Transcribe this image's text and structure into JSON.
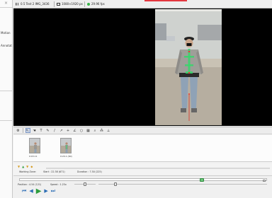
{
  "info_bar": {
    "file_label": "0.5 Test 2 IMG_3436",
    "resolution": "1080×1920 px",
    "framerate": "29.96 fps",
    "accent_color": "#e4383f"
  },
  "left_panel": {
    "items": [
      "Motion",
      "Annotati"
    ]
  },
  "toolbar": {
    "tools": [
      {
        "icon": "pointer-icon",
        "glyph": "↖"
      },
      {
        "icon": "hand-icon",
        "glyph": "☚"
      },
      {
        "icon": "text-icon",
        "glyph": "T"
      },
      {
        "icon": "pencil-icon",
        "glyph": "✎"
      },
      {
        "icon": "line-icon",
        "glyph": "/"
      },
      {
        "icon": "arrow-icon",
        "glyph": "↗"
      },
      {
        "icon": "cross-icon",
        "glyph": "+"
      },
      {
        "icon": "angle-icon",
        "glyph": "∠"
      },
      {
        "icon": "circle-icon",
        "glyph": "○"
      },
      {
        "icon": "grid-icon",
        "glyph": "▦"
      },
      {
        "icon": "magnifier-icon",
        "glyph": "⌕"
      },
      {
        "icon": "plot-icon",
        "glyph": "⁂"
      },
      {
        "icon": "ruler-icon",
        "glyph": "⟂"
      }
    ]
  },
  "keyframes": [
    {
      "label": "0:03.11"
    },
    {
      "label": "0:20.1 (60)"
    }
  ],
  "working_zone": {
    "label": "Working Zone:",
    "start": "Start : 22.38 (671)",
    "duration": "Duration : 7.50 (225)"
  },
  "playback": {
    "position": "Position : 4.54 (121)",
    "speed": "Speed : 1.25x",
    "cursor_fraction": 0.73,
    "speed_fraction": 0.5,
    "position_fraction": 0.1,
    "controls": [
      {
        "name": "skip-start-icon",
        "glyph": "⏮"
      },
      {
        "name": "step-back-icon",
        "glyph": "◀"
      },
      {
        "name": "play-icon",
        "glyph": "▶"
      },
      {
        "name": "step-forward-icon",
        "glyph": "▶"
      },
      {
        "name": "skip-end-icon",
        "glyph": "⏭"
      }
    ]
  }
}
